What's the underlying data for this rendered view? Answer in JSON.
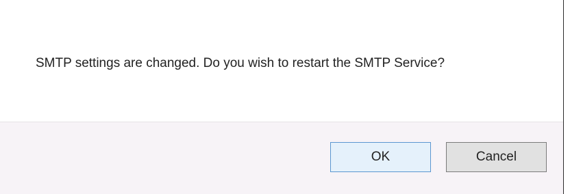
{
  "dialog": {
    "message": "SMTP settings are changed. Do you wish to restart the SMTP Service?",
    "buttons": {
      "ok_label": "OK",
      "cancel_label": "Cancel"
    }
  },
  "colors": {
    "footer_background": "#f7f3f7",
    "ok_button_background": "#e5f1fb",
    "ok_button_border": "#5a96d0",
    "cancel_button_background": "#e1e1e1",
    "cancel_button_border": "#7a7a7a",
    "text": "#222222"
  }
}
